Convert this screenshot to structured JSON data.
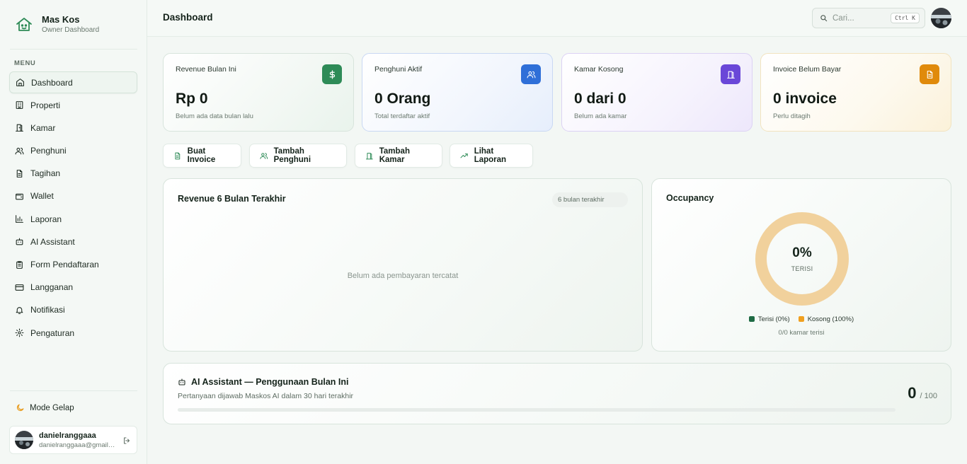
{
  "brand": {
    "name": "Mas Kos",
    "subtitle": "Owner Dashboard"
  },
  "menu_label": "MENU",
  "nav": [
    {
      "label": "Dashboard",
      "icon": "home-icon",
      "active": true
    },
    {
      "label": "Properti",
      "icon": "building-icon"
    },
    {
      "label": "Kamar",
      "icon": "door-icon"
    },
    {
      "label": "Penghuni",
      "icon": "users-icon"
    },
    {
      "label": "Tagihan",
      "icon": "file-text-icon"
    },
    {
      "label": "Wallet",
      "icon": "wallet-icon"
    },
    {
      "label": "Laporan",
      "icon": "bar-chart-icon"
    },
    {
      "label": "AI Assistant",
      "icon": "bot-icon"
    },
    {
      "label": "Form Pendaftaran",
      "icon": "clipboard-icon"
    },
    {
      "label": "Langganan",
      "icon": "credit-card-icon"
    },
    {
      "label": "Notifikasi",
      "icon": "bell-icon"
    },
    {
      "label": "Pengaturan",
      "icon": "gear-icon"
    }
  ],
  "mode": {
    "label": "Mode Gelap",
    "icon": "moon-icon"
  },
  "user": {
    "name": "danielranggaaa",
    "email": "danielranggaaa@gmail.com"
  },
  "header": {
    "title": "Dashboard",
    "search_placeholder": "Cari...",
    "shortcut": "Ctrl K"
  },
  "stats": [
    {
      "label": "Revenue Bulan Ini",
      "value": "Rp 0",
      "sub": "Belum ada data bulan lalu",
      "icon": "dollar-icon",
      "accent": "#2e8b57"
    },
    {
      "label": "Penghuni Aktif",
      "value": "0 Orang",
      "sub": "Total terdaftar aktif",
      "icon": "users-icon",
      "accent": "#2f6fd8"
    },
    {
      "label": "Kamar Kosong",
      "value": "0 dari 0",
      "sub": "Belum ada kamar",
      "icon": "door-icon",
      "accent": "#6a47d8"
    },
    {
      "label": "Invoice Belum Bayar",
      "value": "0 invoice",
      "sub": "Perlu ditagih",
      "icon": "file-text-icon",
      "accent": "#e08a0b"
    }
  ],
  "actions": [
    {
      "label": "Buat Invoice",
      "icon": "file-text-icon"
    },
    {
      "label": "Tambah Penghuni",
      "icon": "users-icon"
    },
    {
      "label": "Tambah Kamar",
      "icon": "door-icon"
    },
    {
      "label": "Lihat Laporan",
      "icon": "trending-up-icon"
    }
  ],
  "revenue": {
    "title": "Revenue 6 Bulan Terakhir",
    "range": "6 bulan terakhir",
    "empty": "Belum ada pembayaran tercatat"
  },
  "occupancy": {
    "title": "Occupancy",
    "percent_label": "0%",
    "status": "TERISI",
    "filled_fraction": 0,
    "legend": [
      {
        "label": "Terisi (0%)",
        "color": "#1f6b45"
      },
      {
        "label": "Kosong (100%)",
        "color": "#f0a020"
      }
    ],
    "ring_color": "#f1d19c",
    "summary": "0/0 kamar terisi"
  },
  "ai": {
    "title": "AI Assistant — Penggunaan Bulan Ini",
    "subtitle": "Pertanyaan dijawab Maskos AI dalam 30 hari terakhir",
    "used": "0",
    "limit": "/ 100",
    "fraction": 0
  }
}
